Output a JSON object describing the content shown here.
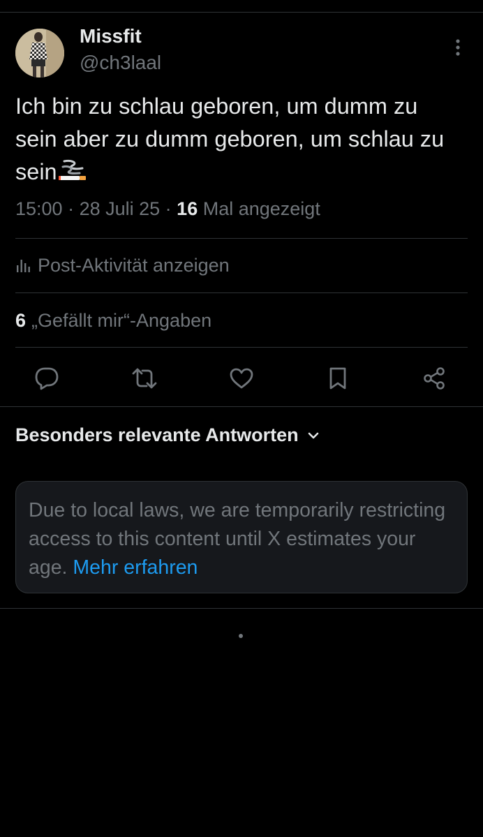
{
  "colors": {
    "background": "#000000",
    "text_primary": "#e7e9ea",
    "text_secondary": "#71767b",
    "divider": "#2f3336",
    "link": "#1d9bf0",
    "notice_bg": "#16181c"
  },
  "post": {
    "author": {
      "display_name": "Missfit",
      "handle": "@ch3laal"
    },
    "text": "Ich bin zu schlau geboren, um dumm zu sein aber zu dumm geboren, um schlau zu sein",
    "emoji": "smoking-cigarette",
    "meta": {
      "time": "15:00",
      "sep1": " · ",
      "date": "28 Juli 25",
      "sep2": " · ",
      "views_count": "16",
      "views_label": " Mal angezeigt"
    },
    "activity_label": "Post-Aktivität anzeigen",
    "likes": {
      "count": "6",
      "label": "„Gefällt mir“-Angaben"
    },
    "actions": [
      {
        "name": "reply",
        "icon": "speech-bubble-icon"
      },
      {
        "name": "repost",
        "icon": "repost-arrows-icon"
      },
      {
        "name": "like",
        "icon": "heart-icon"
      },
      {
        "name": "bookmark",
        "icon": "bookmark-icon"
      },
      {
        "name": "share",
        "icon": "share-nodes-icon"
      }
    ]
  },
  "replies": {
    "sort_label": "Besonders relevante Antworten",
    "notice": {
      "text": "Due to local laws, we are temporarily restricting access to this content until X estimates your age. ",
      "link_text": "Mehr erfahren"
    }
  }
}
